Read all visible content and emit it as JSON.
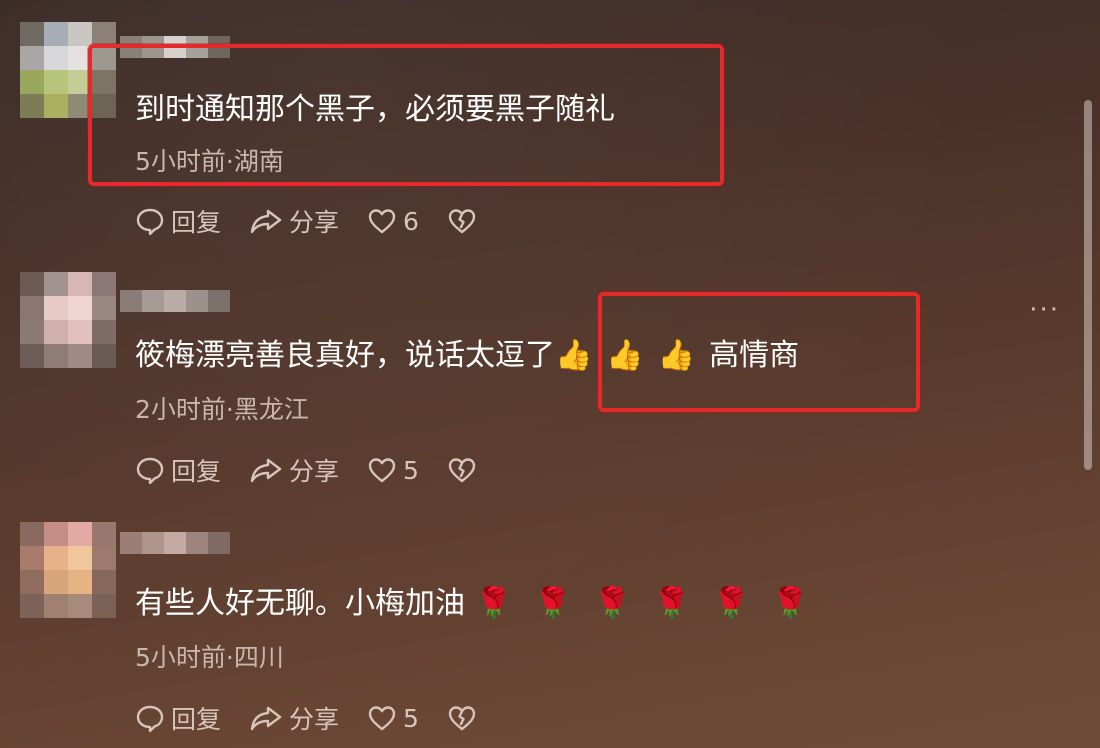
{
  "comments": [
    {
      "text": "到时通知那个黑子，必须要黑子随礼",
      "meta": "5小时前·湖南",
      "reply": "回复",
      "share": "分享",
      "likes": "6",
      "avatar_colors": [
        "#6f6a62",
        "#a6adb7",
        "#c9c6c2",
        "#8b8176",
        "#a9a7a5",
        "#d8d7dc",
        "#e4e1de",
        "#9d9890",
        "#9aa85d",
        "#b7c47b",
        "#c4cd98",
        "#7d7464",
        "#7c7c56",
        "#aab05f",
        "#8e8a73",
        "#6d6456"
      ],
      "name_colors": [
        "#8a807a",
        "#9d968f",
        "#d6d1cf",
        "#a7a19c",
        "#6f675f"
      ]
    },
    {
      "text": "筱梅漂亮善良真好，说话太逗了",
      "emoji": [
        "👍",
        "👍",
        "👍"
      ],
      "text_after": "高情商",
      "meta": "2小时前·黑龙江",
      "reply": "回复",
      "share": "分享",
      "likes": "5",
      "avatar_colors": [
        "#6d5a55",
        "#a29290",
        "#d7b7b6",
        "#8c7876",
        "#8b7673",
        "#e7c9c5",
        "#f1d5d2",
        "#9a8784",
        "#8c7a76",
        "#cfb0ad",
        "#e2c0bd",
        "#7f6c69",
        "#6c5c58",
        "#8f7c79",
        "#a08a87",
        "#6a5a55"
      ],
      "name_colors": [
        "#8a7d78",
        "#a69a95",
        "#b9aca7",
        "#9d918c",
        "#7d716c"
      ]
    },
    {
      "text": "有些人好无聊。小梅加油",
      "emoji": [
        "🌹",
        "🌹",
        "🌹",
        "🌹",
        "🌹",
        "🌹"
      ],
      "meta": "5小时前·四川",
      "reply": "回复",
      "share": "分享",
      "likes": "5",
      "avatar_colors": [
        "#8a6a60",
        "#c58d84",
        "#e2aaa3",
        "#96786f",
        "#a97b6c",
        "#e7b28a",
        "#f0c79a",
        "#9c7a6e",
        "#8f6c5e",
        "#d9a57a",
        "#e6b484",
        "#86685c",
        "#7c6258",
        "#a08070",
        "#a88a7a",
        "#7a6055"
      ],
      "name_colors": [
        "#9b7e75",
        "#b0958d",
        "#c4aaa2",
        "#9d857d",
        "#7f6b64"
      ]
    }
  ],
  "more_label": "···"
}
